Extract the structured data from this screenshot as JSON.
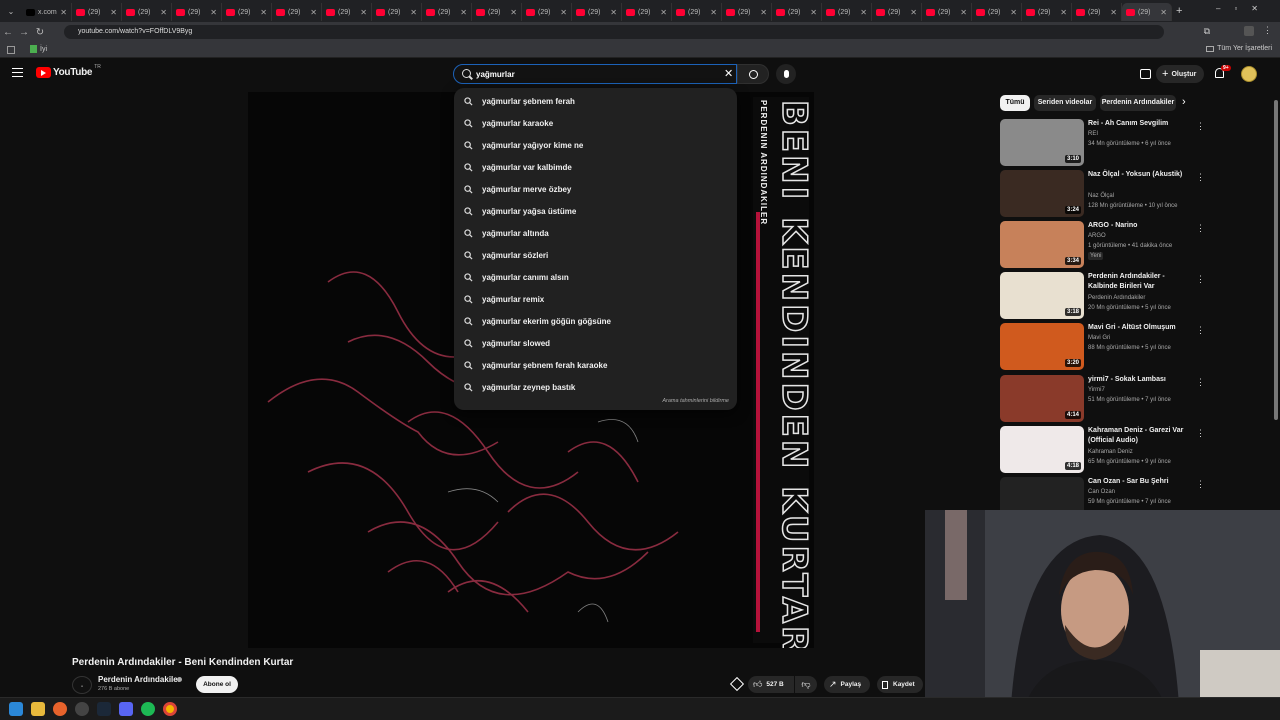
{
  "browser": {
    "tabs": [
      "x.com",
      "(29)",
      "(29)",
      "(29)",
      "(29)",
      "(29)",
      "(29)",
      "(29)",
      "(29)",
      "(29)",
      "(29)",
      "(29)",
      "(29)",
      "(29)",
      "(29)",
      "(29)",
      "(29)",
      "(29)",
      "(29)",
      "(29)",
      "(29)",
      "(29)",
      "(29)"
    ],
    "url": "youtube.com/watch?v=FOffDLV9Byg",
    "bookmark_label": "İyi",
    "all_bookmarks": "Tüm Yer İşaretleri"
  },
  "header": {
    "logo_text": "YouTube",
    "logo_sup": "TR",
    "search_value": "yağmurlar",
    "create_label": "Oluştur",
    "notif_badge": "9+"
  },
  "suggestions": {
    "items": [
      "yağmurlar şebnem ferah",
      "yağmurlar karaoke",
      "yağmurlar yağıyor kime ne",
      "yağmurlar var kalbimde",
      "yağmurlar merve özbey",
      "yağmurlar yağsa üstüme",
      "yağmurlar altında",
      "yağmurlar sözleri",
      "yağmurlar canımı alsın",
      "yağmurlar remix",
      "yağmurlar ekerim göğün göğsüne",
      "yağmurlar slowed",
      "yağmurlar şebnem ferah karaoke",
      "yağmurlar zeynep bastık"
    ],
    "report": "Arama tahminlerini bildirme"
  },
  "video": {
    "art_title": "BENI KENDINDEN KURTAR",
    "art_artist": "PERDENIN ARDINDAKILER",
    "title": "Perdenin Ardındakiler - Beni Kendinden Kurtar",
    "channel": "Perdenin Ardındakiler",
    "subs": "276 B abone",
    "subscribe": "Abone ol",
    "likes": "527 B",
    "share": "Paylaş",
    "save": "Kaydet"
  },
  "chips": [
    "Tümü",
    "Seriden videolar",
    "Perdenin Ardındakiler"
  ],
  "recommendations": [
    {
      "title": "Rei - Ah Canım Sevgilim",
      "channel": "REI",
      "meta": "34 Mn görüntüleme • 6 yıl önce",
      "dur": "3:10",
      "color": "#8a8a8a"
    },
    {
      "title": "Naz Ölçal - Yoksun (Akustik)",
      "channel": "Naz Ölçal",
      "meta": "128 Mn görüntüleme • 10 yıl önce",
      "dur": "3:24",
      "color": "#3a2a22"
    },
    {
      "title": "ARGO - Narino",
      "channel": "ARGO",
      "meta": "1 görüntüleme • 41 dakika önce",
      "badge": "Yeni",
      "dur": "3:34",
      "color": "#c7815a"
    },
    {
      "title": "Perdenin Ardındakiler - Kalbinde Birileri Var",
      "channel": "Perdenin Ardındakiler",
      "meta": "20 Mn görüntüleme • 5 yıl önce",
      "dur": "3:18",
      "color": "#e8e0d0"
    },
    {
      "title": "Mavi Gri - Altüst Olmuşum",
      "channel": "Mavi Gri",
      "meta": "88 Mn görüntüleme • 5 yıl önce",
      "dur": "3:20",
      "color": "#d05a1e"
    },
    {
      "title": "yirmi7 - Sokak Lambası",
      "channel": "Yirmi7",
      "meta": "51 Mn görüntüleme • 7 yıl önce",
      "dur": "4:14",
      "color": "#8a3a2a"
    },
    {
      "title": "Kahraman Deniz - Garezi Var (Official Audio)",
      "channel": "Kahraman Deniz",
      "meta": "65 Mn görüntüleme • 9 yıl önce",
      "dur": "4:18",
      "color": "#efe9e9"
    },
    {
      "title": "Can Ozan - Sar Bu Şehri",
      "channel": "Can Ozan",
      "meta": "59 Mn görüntüleme • 7 yıl önce",
      "dur": "",
      "color": "#222222"
    }
  ]
}
